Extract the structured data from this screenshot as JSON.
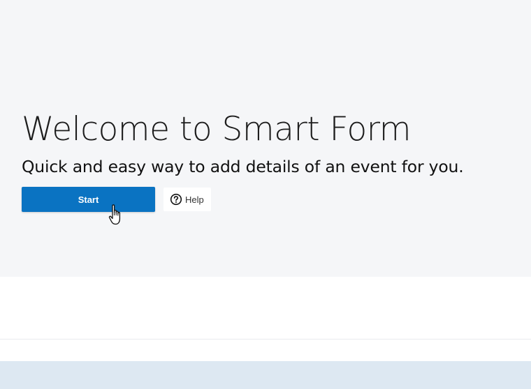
{
  "hero": {
    "title": "Welcome to Smart Form",
    "subtitle": "Quick and easy way to add details of an event for you.",
    "start_label": "Start",
    "help_label": "Help"
  },
  "icons": {
    "help": "question-circle-icon",
    "cursor": "hand-pointer-cursor"
  },
  "colors": {
    "hero_background": "#f5f6f8",
    "primary_button": "#0a73c2",
    "bottom_band": "#dde8f2"
  }
}
